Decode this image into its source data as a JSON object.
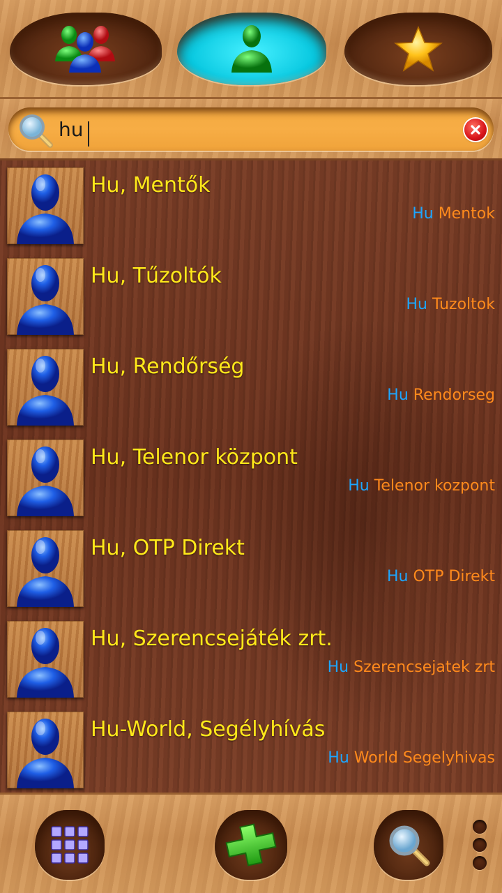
{
  "search": {
    "value": "hu"
  },
  "contacts": [
    {
      "name": "Hu, Mentők",
      "key": "Hu",
      "detail": "Mentok"
    },
    {
      "name": "Hu, Tűzoltók",
      "key": "Hu",
      "detail": "Tuzoltok"
    },
    {
      "name": "Hu, Rendőrség",
      "key": "Hu",
      "detail": "Rendorseg"
    },
    {
      "name": "Hu, Telenor központ",
      "key": "Hu",
      "detail": "Telenor kozpont"
    },
    {
      "name": "Hu, OTP Direkt",
      "key": "Hu",
      "detail": "OTP Direkt"
    },
    {
      "name": "Hu, Szerencsejáték zrt.",
      "key": "Hu",
      "detail": "Szerencsejatek zrt"
    },
    {
      "name": "Hu-World, Segélyhívás",
      "key": "Hu",
      "detail": "World Segelyhivas"
    }
  ],
  "colors": {
    "name": "#ffe81a",
    "key": "#1da6ff",
    "detail": "#ff8a1c",
    "active_tab": "#08c8e0",
    "search_field": "#f7ad45"
  },
  "icons": {
    "tab_groups": "group-people-icon",
    "tab_contacts": "contact-person-icon",
    "tab_favorites": "star-icon",
    "keypad": "keypad-icon",
    "add": "plus-icon",
    "search": "magnifier-icon",
    "menu": "overflow-menu-icon"
  }
}
